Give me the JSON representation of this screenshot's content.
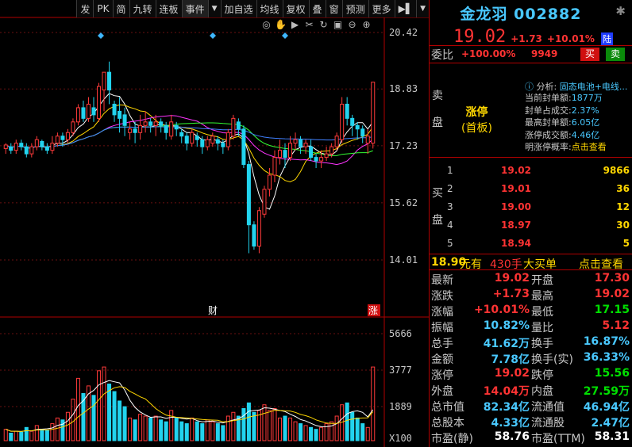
{
  "toolbar": {
    "items": [
      "发",
      "PK",
      "简",
      "九转",
      "连板",
      "事件",
      "▼",
      "加自选",
      "均线",
      "复权",
      "叠",
      "窗",
      "预测",
      "更多",
      "▶▌",
      "▼"
    ]
  },
  "icons": [
    "eye-icon",
    "hand-icon",
    "play-icon",
    "scissors-icon",
    "refresh-icon",
    "lock-icon",
    "zoom-out-icon",
    "zoom-in-icon"
  ],
  "chart_data": {
    "type": "candlestick",
    "price_axis": [
      "20.42",
      "18.83",
      "17.23",
      "15.62",
      "14.01"
    ],
    "volume_axis": [
      "5666",
      "3777",
      "1889",
      "X100"
    ],
    "markers": [
      "财",
      "涨"
    ],
    "candles": [
      [
        17.15,
        17.25,
        17.0,
        17.3
      ],
      [
        17.2,
        17.1,
        17.0,
        17.3
      ],
      [
        17.1,
        17.3,
        17.0,
        17.4
      ],
      [
        17.3,
        17.2,
        17.1,
        17.4
      ],
      [
        17.2,
        17.0,
        16.9,
        17.3
      ],
      [
        17.0,
        17.2,
        16.9,
        17.3
      ],
      [
        17.2,
        17.4,
        17.1,
        17.5
      ],
      [
        17.35,
        17.2,
        17.1,
        17.4
      ],
      [
        17.2,
        17.1,
        17.0,
        17.3
      ],
      [
        17.1,
        17.3,
        17.0,
        17.5
      ],
      [
        17.3,
        17.5,
        17.2,
        17.6
      ],
      [
        17.5,
        17.4,
        17.2,
        17.6
      ],
      [
        17.4,
        17.6,
        17.3,
        17.7
      ],
      [
        17.6,
        17.9,
        17.5,
        18.0
      ],
      [
        17.9,
        18.3,
        17.8,
        18.4
      ],
      [
        18.3,
        18.0,
        17.9,
        18.5
      ],
      [
        18.0,
        18.4,
        17.9,
        18.6
      ],
      [
        18.3,
        18.1,
        17.9,
        18.6
      ],
      [
        18.0,
        18.9,
        17.9,
        19.0
      ],
      [
        18.8,
        19.3,
        18.2,
        19.3
      ],
      [
        19.3,
        18.8,
        18.4,
        19.6
      ],
      [
        18.4,
        18.1,
        17.9,
        18.5
      ],
      [
        18.2,
        18.0,
        17.6,
        18.6
      ],
      [
        18.1,
        17.8,
        17.5,
        18.3
      ],
      [
        17.6,
        17.7,
        17.4,
        17.9
      ],
      [
        17.7,
        17.6,
        17.3,
        17.9
      ],
      [
        17.6,
        17.8,
        17.4,
        18.1
      ],
      [
        17.8,
        17.9,
        17.6,
        18.2
      ],
      [
        17.9,
        17.8,
        17.6,
        18.0
      ],
      [
        17.8,
        17.9,
        17.5,
        18.1
      ],
      [
        17.9,
        17.8,
        17.6,
        18.0
      ],
      [
        17.8,
        17.6,
        17.4,
        17.9
      ],
      [
        17.5,
        17.9,
        17.4,
        18.1
      ],
      [
        17.8,
        17.7,
        17.5,
        17.9
      ],
      [
        17.6,
        17.5,
        17.3,
        17.7
      ],
      [
        17.5,
        17.3,
        17.1,
        17.6
      ],
      [
        17.3,
        17.6,
        17.2,
        17.7
      ],
      [
        17.5,
        17.4,
        17.2,
        17.6
      ],
      [
        17.4,
        17.2,
        17.0,
        17.5
      ],
      [
        17.2,
        17.4,
        17.1,
        17.5
      ],
      [
        17.3,
        17.5,
        17.2,
        17.6
      ],
      [
        17.4,
        17.3,
        17.1,
        17.5
      ],
      [
        17.3,
        17.2,
        17.0,
        17.4
      ],
      [
        17.2,
        17.6,
        17.1,
        17.7
      ],
      [
        17.5,
        18.0,
        17.4,
        18.1
      ],
      [
        17.9,
        17.7,
        17.5,
        18.0
      ],
      [
        17.7,
        16.7,
        16.6,
        17.8
      ],
      [
        16.7,
        15.0,
        14.2,
        16.8
      ],
      [
        15.0,
        14.4,
        14.3,
        15.1
      ],
      [
        14.4,
        15.4,
        14.2,
        15.5
      ],
      [
        15.3,
        16.0,
        15.2,
        16.1
      ],
      [
        16.0,
        16.4,
        15.8,
        16.6
      ],
      [
        16.4,
        16.9,
        16.2,
        17.1
      ],
      [
        16.9,
        17.1,
        16.7,
        17.4
      ],
      [
        17.1,
        16.9,
        16.6,
        17.3
      ],
      [
        16.9,
        17.3,
        16.8,
        17.5
      ],
      [
        17.3,
        17.4,
        17.1,
        17.6
      ],
      [
        17.4,
        17.2,
        17.0,
        17.5
      ],
      [
        17.2,
        17.3,
        17.0,
        17.4
      ],
      [
        17.2,
        16.9,
        16.8,
        17.4
      ],
      [
        16.9,
        16.8,
        16.6,
        17.0
      ],
      [
        16.8,
        16.9,
        16.6,
        17.1
      ],
      [
        16.9,
        17.0,
        16.8,
        17.2
      ],
      [
        17.0,
        17.2,
        16.9,
        17.3
      ],
      [
        17.2,
        17.5,
        17.1,
        17.6
      ],
      [
        17.4,
        18.4,
        17.3,
        18.6
      ],
      [
        18.4,
        18.0,
        17.8,
        18.6
      ],
      [
        18.0,
        17.8,
        17.5,
        18.1
      ],
      [
        17.8,
        17.7,
        17.4,
        17.9
      ],
      [
        17.7,
        17.5,
        17.3,
        17.8
      ],
      [
        17.3,
        17.5,
        17.0,
        17.7
      ],
      [
        17.3,
        19.02,
        17.15,
        19.02
      ]
    ],
    "volumes": [
      600,
      400,
      500,
      450,
      700,
      500,
      800,
      600,
      550,
      900,
      1200,
      1100,
      1500,
      2200,
      3300,
      2500,
      2900,
      2400,
      3700,
      3900,
      3000,
      2600,
      2100,
      1800,
      1200,
      1100,
      1400,
      1300,
      1200,
      1300,
      1100,
      1000,
      1600,
      1200,
      1000,
      900,
      1200,
      1000,
      900,
      1100,
      1000,
      900,
      800,
      1300,
      1500,
      1300,
      1700,
      2000,
      1500,
      1600,
      1900,
      1600,
      1700,
      1200,
      1300,
      1200,
      1000,
      900,
      800,
      700,
      600,
      700,
      900,
      1000,
      1300,
      1900,
      2000,
      1500,
      1200,
      900,
      700,
      3900
    ]
  },
  "quote": {
    "name": "金龙羽 002882",
    "price": "19.02",
    "change": "+1.73",
    "change_pct": "+10.01%",
    "market_tag": "陆"
  },
  "weibi": {
    "label": "委比",
    "pct": "+100.00%",
    "diff": "9949",
    "sell_btn": "买",
    "buy_btn": "卖"
  },
  "sell": {
    "label_sell_1": "卖",
    "label_sell_2": "盘",
    "status_1": "涨停",
    "status_2": "(首板)",
    "analysis_label": "分析:",
    "analysis_value": "固态电池+电线...",
    "details": [
      {
        "k": "当前封单额:",
        "v": "1877万"
      },
      {
        "k": "封单占成交:",
        "v": "2.37%"
      },
      {
        "k": "最高封单额:",
        "v": "6.05亿"
      },
      {
        "k": "涨停成交额:",
        "v": "4.46亿"
      },
      {
        "k": "明涨停概率:",
        "v": "点击查看"
      }
    ]
  },
  "buy": {
    "label_1": "买",
    "label_2": "盘",
    "levels": [
      {
        "idx": "1",
        "price": "19.02",
        "vol": "9866"
      },
      {
        "idx": "2",
        "price": "19.01",
        "vol": "36"
      },
      {
        "idx": "3",
        "price": "19.00",
        "vol": "12"
      },
      {
        "idx": "4",
        "price": "18.97",
        "vol": "30"
      },
      {
        "idx": "5",
        "price": "18.94",
        "vol": "5"
      }
    ]
  },
  "bigorder": {
    "price": "18.90",
    "unit": "元有",
    "qty": "430手",
    "type": "大买单",
    "link": "点击查看"
  },
  "stats": [
    {
      "k1": "最新",
      "v1": "19.02",
      "c1": "#ff3333",
      "k2": "开盘",
      "v2": "17.30",
      "c2": "#ff3333"
    },
    {
      "k1": "涨跌",
      "v1": "+1.73",
      "c1": "#ff3333",
      "k2": "最高",
      "v2": "19.02",
      "c2": "#ff3333"
    },
    {
      "k1": "涨幅",
      "v1": "+10.01%",
      "c1": "#ff3333",
      "k2": "最低",
      "v2": "17.15",
      "c2": "#00e000"
    },
    {
      "k1": "振幅",
      "v1": "10.82%",
      "c1": "#49c8ff",
      "k2": "量比",
      "v2": "5.12",
      "c2": "#ff3333"
    },
    {
      "k1": "总手",
      "v1": "41.62万",
      "c1": "#49c8ff",
      "k2": "换手",
      "v2": "16.87%",
      "c2": "#49c8ff"
    },
    {
      "k1": "金额",
      "v1": "7.78亿",
      "c1": "#49c8ff",
      "k2": "换手(实)",
      "v2": "36.33%",
      "c2": "#49c8ff"
    },
    {
      "k1": "涨停",
      "v1": "19.02",
      "c1": "#ff3333",
      "k2": "跌停",
      "v2": "15.56",
      "c2": "#00e000"
    },
    {
      "k1": "外盘",
      "v1": "14.04万",
      "c1": "#ff3333",
      "k2": "内盘",
      "v2": "27.59万",
      "c2": "#00e000"
    },
    {
      "k1": "总市值",
      "v1": "82.34亿",
      "c1": "#49c8ff",
      "k2": "流通值",
      "v2": "46.94亿",
      "c2": "#49c8ff"
    },
    {
      "k1": "总股本",
      "v1": "4.33亿",
      "c1": "#49c8ff",
      "k2": "流通股",
      "v2": "2.47亿",
      "c2": "#49c8ff"
    },
    {
      "k1": "市盈(静)",
      "v1": "58.76",
      "c1": "#ffffff",
      "k2": "市盈(TTM)",
      "v2": "58.31",
      "c2": "#ffffff"
    }
  ]
}
